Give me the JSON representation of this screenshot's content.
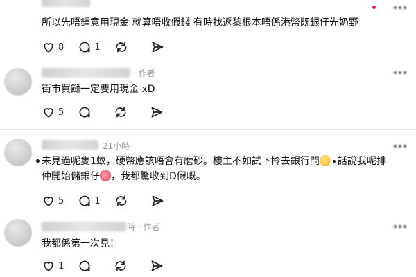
{
  "posts": [
    {
      "time": "",
      "text": "所以先唔鍾意用現金 就算唔收假錢 有時找返黎根本唔係港幣既銀仔先奶野",
      "likes": "8",
      "replies": "1",
      "reposts": "",
      "shares": ""
    },
    {
      "time": "· 作者",
      "text": "街市買餸一定要用現金 xD",
      "likes": "5",
      "replies": "",
      "reposts": "",
      "shares": ""
    },
    {
      "time": "21小時",
      "text_line1_a": "未見過呢隻1蚊，硬幣應該唔會有磨砂。樓主不如試下拎去銀行問",
      "text_line1_b": "話說我呢排",
      "text_line2_a": "仲開始儲銀仔",
      "text_line2_b": "，我都驚收到D假嘅。",
      "likes": "5",
      "replies": "1",
      "reposts": "",
      "shares": ""
    },
    {
      "time": "時 · 作者",
      "text": "我都係第一次見！",
      "likes": "1",
      "replies": "",
      "reposts": "",
      "shares": ""
    }
  ],
  "icons": {
    "like": "heart-icon",
    "reply": "speech-bubble-icon",
    "repost": "repost-icon",
    "share": "send-icon",
    "more": "more-dots-icon",
    "emoji_think": "thinking-face-emoji",
    "emoji_shy": "embarrassed-face-emoji"
  }
}
